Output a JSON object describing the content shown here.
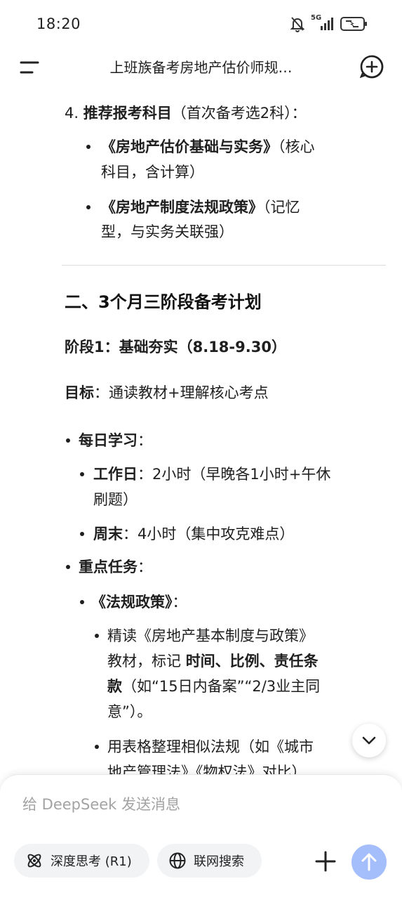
{
  "status_bar": {
    "time": "18:20",
    "network": "5G"
  },
  "header": {
    "title": "上班族备考房地产估价师规…"
  },
  "content": {
    "item4": {
      "num": "4.",
      "label": "推荐报考科目",
      "note": "（首次备考选2科）："
    },
    "subject1": {
      "name": "《房地产估价基础与实务》",
      "note_line1": "（核心",
      "note_line2": "科目，含计算）"
    },
    "subject2": {
      "name": "《房地产制度法规政策》",
      "note_line1": "（记忆",
      "note_line2": "型，与实务关联强）"
    },
    "section2_title": "二、3个月三阶段备考计划",
    "stage1_title": "阶段1：基础夯实（8.18-9.30）",
    "goal": {
      "label": "目标",
      "text": "：通读教材+理解核心考点"
    },
    "daily": {
      "label": "每日学习",
      "colon": "："
    },
    "workday": {
      "label": "工作日",
      "text_line1": "：2小时（早晚各1小时+午休",
      "text_line2": "刷题）"
    },
    "weekend": {
      "label": "周末",
      "text": "：4小时（集中攻克难点）"
    },
    "tasks": {
      "label": "重点任务",
      "colon": "："
    },
    "policy": {
      "label": "《法规政策》",
      "colon": "："
    },
    "read": {
      "line1": "精读《房地产基本制度与政策》",
      "line2_a": "教材，标记",
      "line2_b": "时间、比例、责任条",
      "line3_a": "款",
      "line3_b": "（如“15日内备案”“2/3业主同",
      "line4": "意”）。"
    },
    "table": {
      "line1": "用表格整理相似法规（如《城市",
      "line2": "地产管理法》《物权法》对比）"
    }
  },
  "input": {
    "placeholder": "给 DeepSeek 发送消息",
    "deep_think_label": "深度思考 (R1)",
    "web_search_label": "联网搜索"
  }
}
